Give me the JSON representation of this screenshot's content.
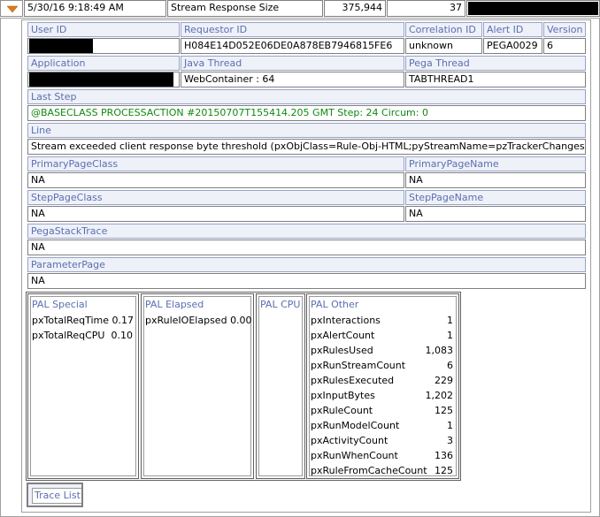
{
  "summary": {
    "timestamp": "5/30/16 9:18:49 AM",
    "alert_type": "Stream Response Size",
    "value": "375,944",
    "count": "37"
  },
  "fields": {
    "user_id_label": "User ID",
    "requestor_id_label": "Requestor ID",
    "requestor_id": "H084E14D052E06DE0A878EB7946815FE6",
    "correlation_id_label": "Correlation ID",
    "correlation_id": "unknown",
    "alert_id_label": "Alert ID",
    "alert_id": "PEGA0029",
    "version_label": "Version",
    "version": "6",
    "application_label": "Application",
    "java_thread_label": "Java Thread",
    "java_thread": "WebContainer : 64",
    "pega_thread_label": "Pega Thread",
    "pega_thread": "TABTHREAD1",
    "last_step_label": "Last Step",
    "last_step": "@BASECLASS PROCESSACTION #20150707T155414.205 GMT Step: 24 Circum: 0",
    "line_label": "Line",
    "line": "Stream exceeded client response byte threshold (pxObjClass=Rule-Obj-HTML;pyStreamName=pzTrackerChanges;).",
    "primary_page_class_label": "PrimaryPageClass",
    "primary_page_class": "NA",
    "primary_page_name_label": "PrimaryPageName",
    "primary_page_name": "NA",
    "step_page_class_label": "StepPageClass",
    "step_page_class": "NA",
    "step_page_name_label": "StepPageName",
    "step_page_name": "NA",
    "pega_stack_trace_label": "PegaStackTrace",
    "pega_stack_trace": "NA",
    "parameter_page_label": "ParameterPage",
    "parameter_page": "NA"
  },
  "pal": {
    "special": {
      "title": "PAL Special",
      "rows": [
        {
          "name": "pxTotalReqTime",
          "value": "0.17"
        },
        {
          "name": "pxTotalReqCPU",
          "value": "0.10"
        }
      ]
    },
    "elapsed": {
      "title": "PAL Elapsed",
      "rows": [
        {
          "name": "pxRuleIOElapsed",
          "value": "0.00"
        }
      ]
    },
    "cpu": {
      "title": "PAL CPU",
      "rows": []
    },
    "other": {
      "title": "PAL Other",
      "rows": [
        {
          "name": "pxInteractions",
          "value": "1"
        },
        {
          "name": "pxAlertCount",
          "value": "1"
        },
        {
          "name": "pxRulesUsed",
          "value": "1,083"
        },
        {
          "name": "pxRunStreamCount",
          "value": "6"
        },
        {
          "name": "pxRulesExecuted",
          "value": "229"
        },
        {
          "name": "pxInputBytes",
          "value": "1,202"
        },
        {
          "name": "pxRuleCount",
          "value": "125"
        },
        {
          "name": "pxRunModelCount",
          "value": "1"
        },
        {
          "name": "pxActivityCount",
          "value": "3"
        },
        {
          "name": "pxRunWhenCount",
          "value": "136"
        },
        {
          "name": "pxRuleFromCacheCount",
          "value": "125"
        }
      ]
    }
  },
  "trace_list_label": "Trace List",
  "colors": {
    "label_text": "#5a6fb0",
    "label_bg": "#eef1f8",
    "step_text": "#118811",
    "expand_arrow": "#e07a1a"
  }
}
